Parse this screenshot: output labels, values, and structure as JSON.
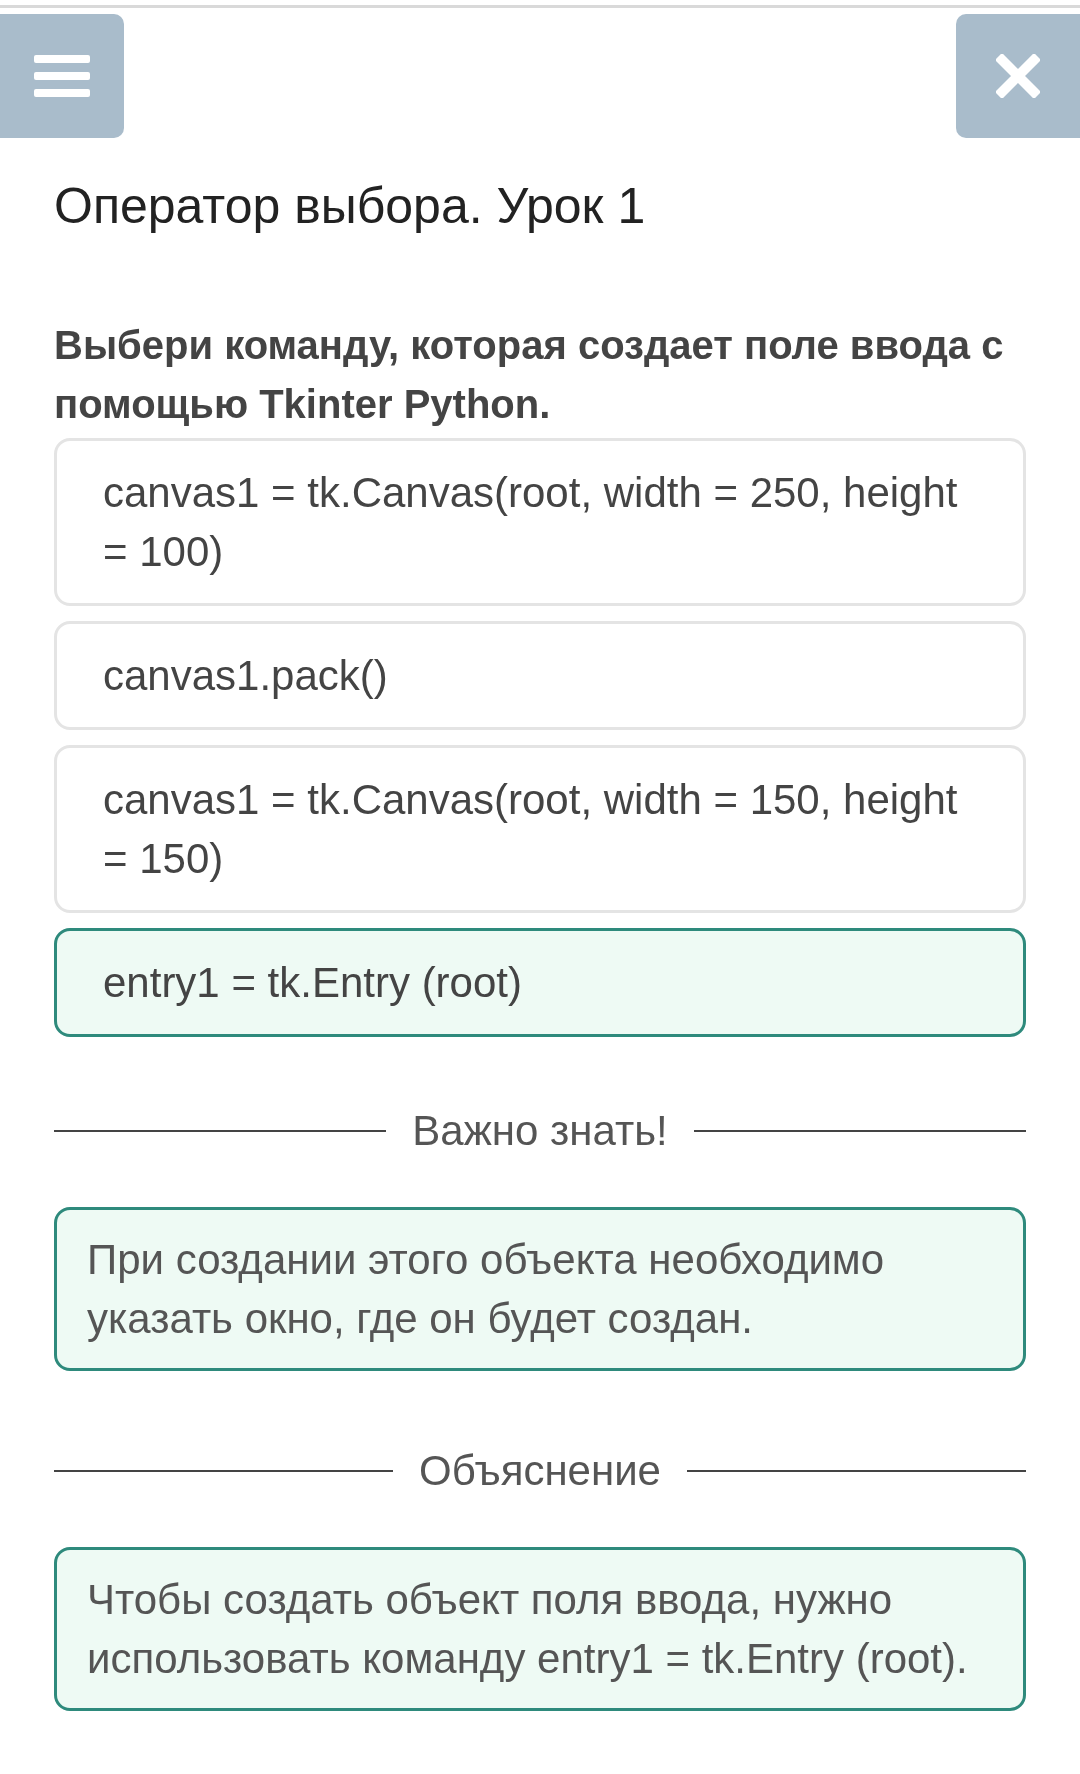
{
  "title": "Оператор выбора. Урок 1",
  "question": "Выбери команду, которая создает поле ввода с помощью Tkinter Python.",
  "options": [
    {
      "text": "canvas1 = tk.Canvas(root, width = 250, height = 100)",
      "selected": false
    },
    {
      "text": "canvas1.pack()",
      "selected": false
    },
    {
      "text": "canvas1 = tk.Canvas(root, width = 150, height = 150)",
      "selected": false
    },
    {
      "text": "entry1 = tk.Entry (root)",
      "selected": true
    }
  ],
  "sections": [
    {
      "heading": "Важно знать!",
      "text": "При создании этого объекта необходимо указать окно, где он будет создан."
    },
    {
      "heading": "Объяснение",
      "text": "Чтобы создать объект поля ввода, нужно использовать команду entry1 = tk.Entry (root)."
    }
  ]
}
